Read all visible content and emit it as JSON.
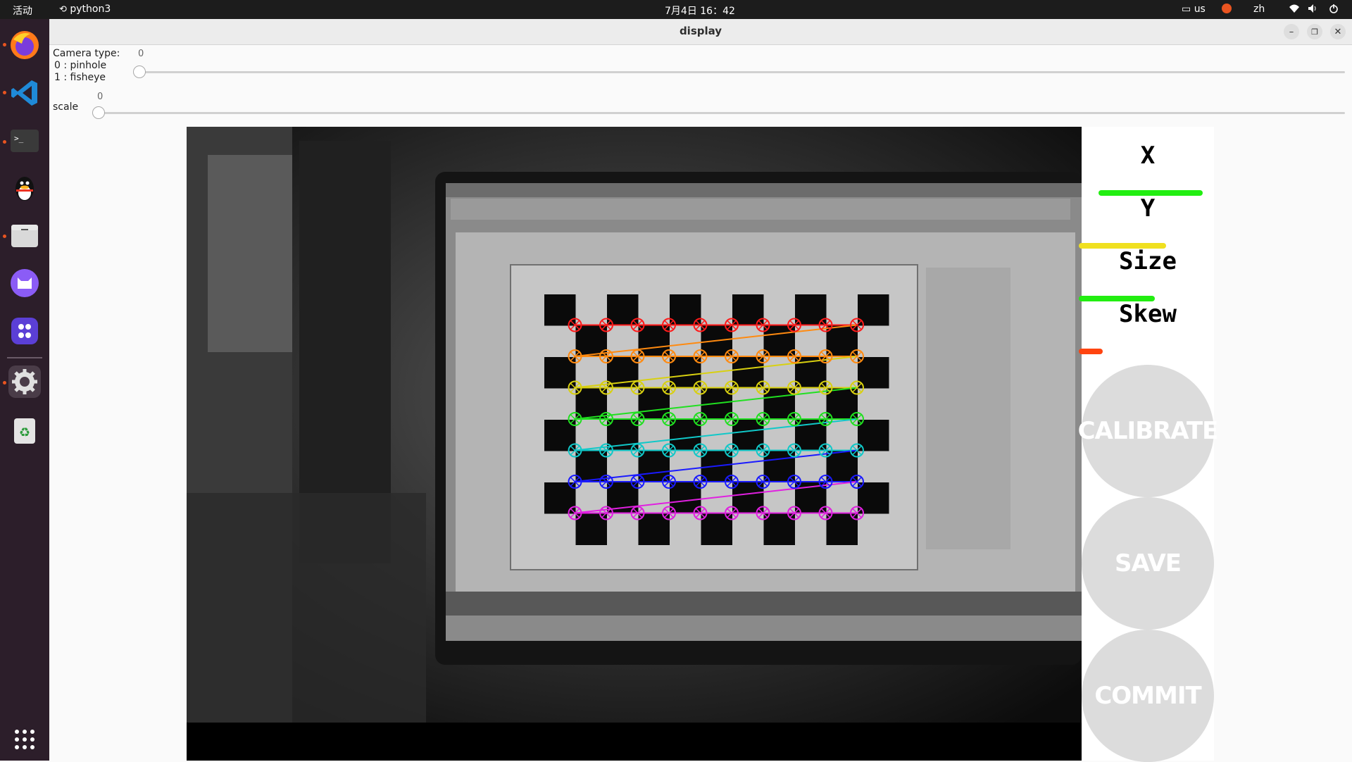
{
  "topbar": {
    "activities": "活动",
    "app": "python3",
    "clock": "7月4日  16：42",
    "keyboard": "us",
    "lang": "zh"
  },
  "window": {
    "title": "display"
  },
  "controls": {
    "camera_type_label": "Camera type:",
    "camera_type_opt0": "0 : pinhole",
    "camera_type_opt1": "1 : fisheye",
    "camera_type_value": "0",
    "scale_label": "scale",
    "scale_value": "0"
  },
  "side_panel": {
    "x_label": "X",
    "y_label": "Y",
    "size_label": "Size",
    "skew_label": "Skew",
    "calibrate": "CALIBRATE",
    "save": "SAVE",
    "commit": "COMMIT",
    "colors": {
      "x_bar": "#22ee11",
      "y_bar": "#f0e020",
      "size_bar": "#22ee11",
      "skew_bar": "#ff4410"
    }
  },
  "camera_feed": {
    "corner_colors": [
      "#ff1a1a",
      "#ff8a10",
      "#d8d010",
      "#20e020",
      "#10c8c8",
      "#1a1aff",
      "#e020e0"
    ]
  },
  "dock_icons": [
    "firefox-icon",
    "vscode-icon",
    "terminal-icon",
    "qq-icon",
    "files-icon",
    "cat-app-icon",
    "app-icon",
    "settings-icon",
    "trash-icon",
    "app-grid-icon"
  ]
}
